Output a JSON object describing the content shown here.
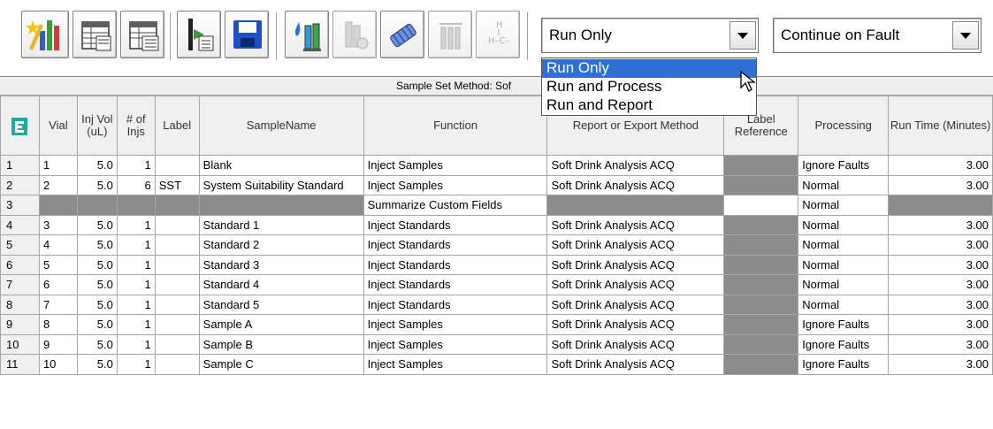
{
  "toolbar": {
    "buttons": [
      {
        "name": "new-method-icon"
      },
      {
        "name": "sample-set-icon"
      },
      {
        "name": "sample-set-edit-icon"
      },
      {
        "name": "import-icon"
      },
      {
        "name": "save-icon"
      },
      {
        "name": "inject-icon"
      },
      {
        "name": "flask-icon"
      },
      {
        "name": "column-icon"
      },
      {
        "name": "processing-icon"
      },
      {
        "name": "structure-icon"
      }
    ],
    "mode_combo_value": "Run Only",
    "fault_combo_value": "Continue on Fault"
  },
  "dropdown": {
    "options": [
      "Run Only",
      "Run and Process",
      "Run and Report"
    ],
    "selected_index": 0
  },
  "grid": {
    "title": "Sample Set Method: Sof",
    "columns": {
      "vial": "Vial",
      "inj_vol": "Inj Vol (uL)",
      "num_injs": "# of Injs",
      "label": "Label",
      "sample_name": "SampleName",
      "function": "Function",
      "report_method": "Report or Export Method",
      "label_reference": "Label Reference",
      "processing": "Processing",
      "run_time": "Run Time (Minutes)"
    },
    "rows": [
      {
        "num": "1",
        "vial": "1",
        "inj_vol": "5.0",
        "injs": "1",
        "label": "",
        "sample": "Blank",
        "function": "Inject Samples",
        "method": "Soft Drink Analysis ACQ",
        "processing": "Ignore Faults",
        "run_time": "3.00"
      },
      {
        "num": "2",
        "vial": "2",
        "inj_vol": "5.0",
        "injs": "6",
        "label": "SST",
        "sample": "System Suitability Standard",
        "function": "Inject Samples",
        "method": "Soft Drink Analysis ACQ",
        "processing": "Normal",
        "run_time": "3.00"
      },
      {
        "num": "3",
        "vial": "",
        "inj_vol": "",
        "injs": "",
        "label": "",
        "sample": "",
        "function": "Summarize Custom Fields",
        "method": "",
        "processing": "Normal",
        "run_time": ""
      },
      {
        "num": "4",
        "vial": "3",
        "inj_vol": "5.0",
        "injs": "1",
        "label": "",
        "sample": "Standard 1",
        "function": "Inject Standards",
        "method": "Soft Drink Analysis ACQ",
        "processing": "Normal",
        "run_time": "3.00"
      },
      {
        "num": "5",
        "vial": "4",
        "inj_vol": "5.0",
        "injs": "1",
        "label": "",
        "sample": "Standard 2",
        "function": "Inject Standards",
        "method": "Soft Drink Analysis ACQ",
        "processing": "Normal",
        "run_time": "3.00"
      },
      {
        "num": "6",
        "vial": "5",
        "inj_vol": "5.0",
        "injs": "1",
        "label": "",
        "sample": "Standard 3",
        "function": "Inject Standards",
        "method": "Soft Drink Analysis ACQ",
        "processing": "Normal",
        "run_time": "3.00"
      },
      {
        "num": "7",
        "vial": "6",
        "inj_vol": "5.0",
        "injs": "1",
        "label": "",
        "sample": "Standard 4",
        "function": "Inject Standards",
        "method": "Soft Drink Analysis ACQ",
        "processing": "Normal",
        "run_time": "3.00"
      },
      {
        "num": "8",
        "vial": "7",
        "inj_vol": "5.0",
        "injs": "1",
        "label": "",
        "sample": "Standard 5",
        "function": "Inject Standards",
        "method": "Soft Drink Analysis ACQ",
        "processing": "Normal",
        "run_time": "3.00"
      },
      {
        "num": "9",
        "vial": "8",
        "inj_vol": "5.0",
        "injs": "1",
        "label": "",
        "sample": "Sample A",
        "function": "Inject Samples",
        "method": "Soft Drink Analysis ACQ",
        "processing": "Ignore Faults",
        "run_time": "3.00"
      },
      {
        "num": "10",
        "vial": "9",
        "inj_vol": "5.0",
        "injs": "1",
        "label": "",
        "sample": "Sample B",
        "function": "Inject Samples",
        "method": "Soft Drink Analysis ACQ",
        "processing": "Ignore Faults",
        "run_time": "3.00"
      },
      {
        "num": "11",
        "vial": "10",
        "inj_vol": "5.0",
        "injs": "1",
        "label": "",
        "sample": "Sample C",
        "function": "Inject Samples",
        "method": "Soft Drink Analysis ACQ",
        "processing": "Ignore Faults",
        "run_time": "3.00"
      }
    ]
  }
}
